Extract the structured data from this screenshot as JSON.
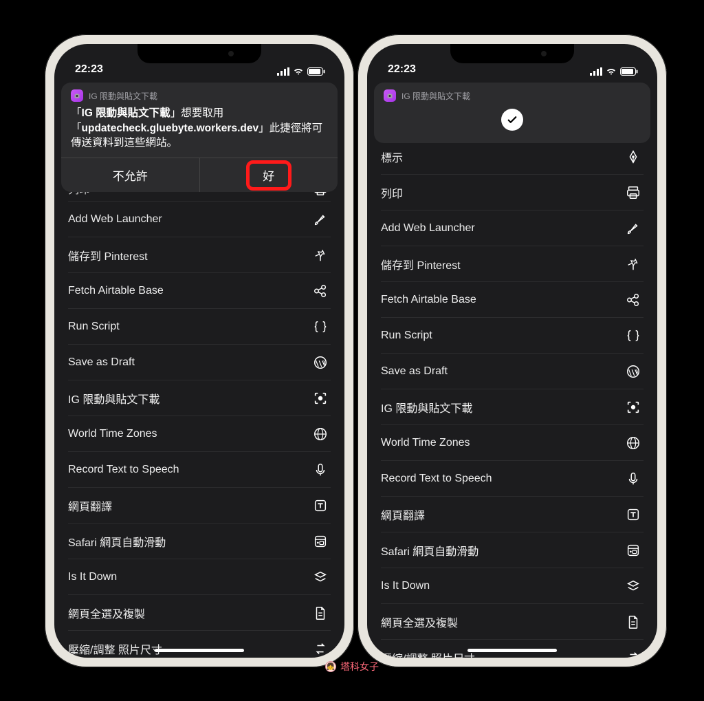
{
  "status": {
    "time": "22:23"
  },
  "banner": {
    "title": "IG 限動與貼文下載",
    "msg_pre": "「",
    "msg_bold1": "IG 限動與貼文下載",
    "msg_mid": "」想要取用「",
    "msg_bold2": "updatecheck.gluebyte.workers.dev",
    "msg_post": "」此捷徑將可傳送資料到這些網站。",
    "deny": "不允許",
    "allow": "好"
  },
  "left_rows": [
    {
      "label": "列印",
      "icon": "print"
    },
    {
      "label": "Add Web Launcher",
      "icon": "brush"
    },
    {
      "label": "儲存到 Pinterest",
      "icon": "pin"
    },
    {
      "label": "Fetch Airtable Base",
      "icon": "share-nodes"
    },
    {
      "label": "Run Script",
      "icon": "braces"
    },
    {
      "label": "Save as Draft",
      "icon": "wordpress"
    },
    {
      "label": "IG 限動與貼文下載",
      "icon": "capture"
    },
    {
      "label": "World Time Zones",
      "icon": "globe"
    },
    {
      "label": "Record Text to Speech",
      "icon": "mic"
    },
    {
      "label": "網頁翻譯",
      "icon": "t-square"
    },
    {
      "label": "Safari 網頁自動滑動",
      "icon": "browser"
    },
    {
      "label": "Is It Down",
      "icon": "layers"
    },
    {
      "label": "網頁全選及複製",
      "icon": "doc"
    },
    {
      "label": "壓縮/調整 照片尺寸",
      "icon": "repeat"
    }
  ],
  "right_rows": [
    {
      "label": "標示",
      "icon": "pen-tip"
    },
    {
      "label": "列印",
      "icon": "print"
    },
    {
      "label": "Add Web Launcher",
      "icon": "brush"
    },
    {
      "label": "儲存到 Pinterest",
      "icon": "pin"
    },
    {
      "label": "Fetch Airtable Base",
      "icon": "share-nodes"
    },
    {
      "label": "Run Script",
      "icon": "braces"
    },
    {
      "label": "Save as Draft",
      "icon": "wordpress"
    },
    {
      "label": "IG 限動與貼文下載",
      "icon": "capture"
    },
    {
      "label": "World Time Zones",
      "icon": "globe"
    },
    {
      "label": "Record Text to Speech",
      "icon": "mic"
    },
    {
      "label": "網頁翻譯",
      "icon": "t-square"
    },
    {
      "label": "Safari 網頁自動滑動",
      "icon": "browser"
    },
    {
      "label": "Is It Down",
      "icon": "layers"
    },
    {
      "label": "網頁全選及複製",
      "icon": "doc"
    },
    {
      "label": "壓縮/調整 照片尺寸",
      "icon": "repeat"
    }
  ],
  "watermark": "塔科女子"
}
